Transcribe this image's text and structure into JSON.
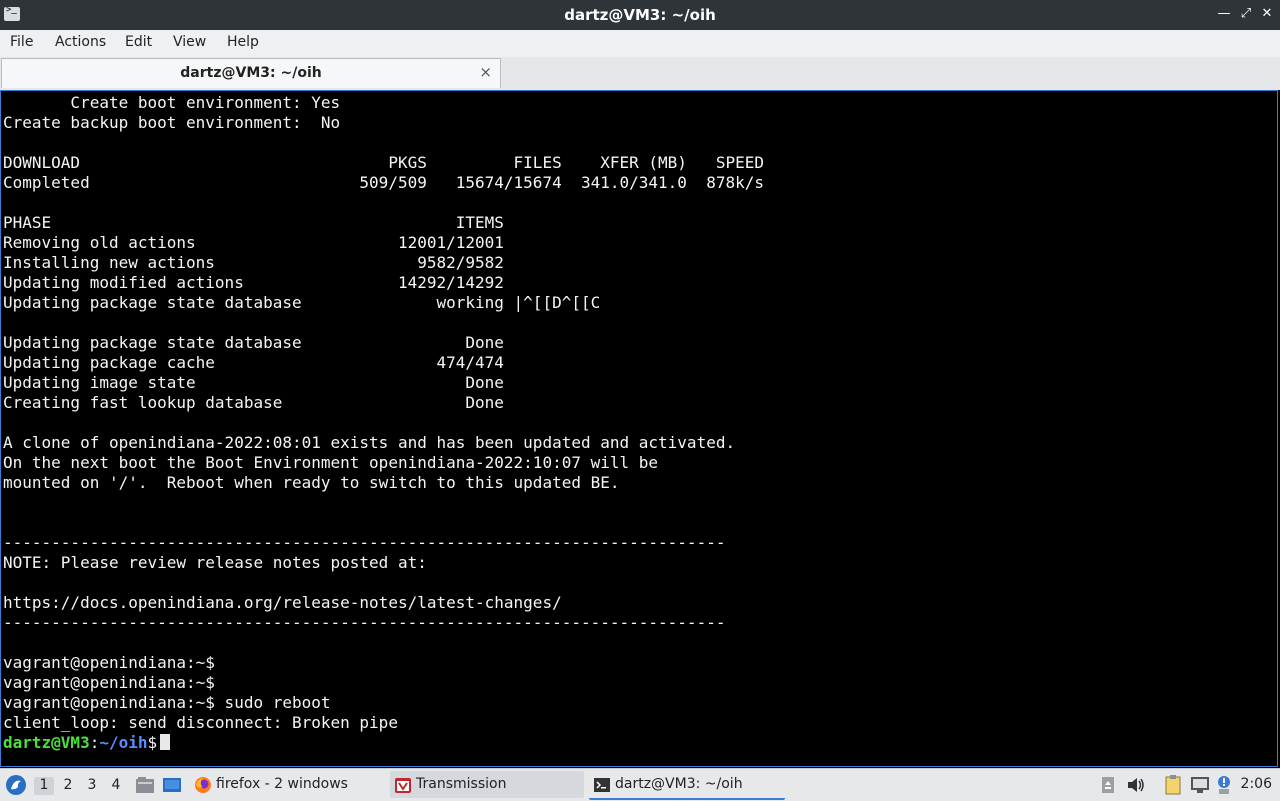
{
  "window": {
    "title": "dartz@VM3: ~/oih"
  },
  "menu": [
    "File",
    "Actions",
    "Edit",
    "View",
    "Help"
  ],
  "tab": {
    "label": "dartz@VM3: ~/oih",
    "close": "×"
  },
  "terminal": {
    "lines": [
      "       Create boot environment: Yes",
      "Create backup boot environment:  No",
      "",
      "DOWNLOAD                                PKGS         FILES    XFER (MB)   SPEED",
      "Completed                            509/509   15674/15674  341.0/341.0  878k/s",
      "",
      "PHASE                                          ITEMS",
      "Removing old actions                     12001/12001",
      "Installing new actions                     9582/9582",
      "Updating modified actions                14292/14292",
      "Updating package state database              working |^[[D^[[C",
      "",
      "Updating package state database                 Done",
      "Updating package cache                       474/474",
      "Updating image state                            Done",
      "Creating fast lookup database                   Done",
      "",
      "A clone of openindiana-2022:08:01 exists and has been updated and activated.",
      "On the next boot the Boot Environment openindiana-2022:10:07 will be",
      "mounted on '/'.  Reboot when ready to switch to this updated BE.",
      "",
      "",
      "---------------------------------------------------------------------------",
      "NOTE: Please review release notes posted at:",
      "",
      "https://docs.openindiana.org/release-notes/latest-changes/",
      "---------------------------------------------------------------------------",
      "",
      "vagrant@openindiana:~$",
      "vagrant@openindiana:~$",
      "vagrant@openindiana:~$ sudo reboot",
      "client_loop: send disconnect: Broken pipe"
    ],
    "prompt": {
      "user_host": "dartz@VM3",
      "sep": ":",
      "path": "~/oih",
      "symbol": "$"
    }
  },
  "taskbar": {
    "workspaces": [
      "1",
      "2",
      "3",
      "4"
    ],
    "active_workspace": "1",
    "tasks": [
      {
        "label": "firefox - 2 windows",
        "icon": "firefox-icon"
      },
      {
        "label": "Transmission",
        "icon": "transmission-icon"
      },
      {
        "label": "dartz@VM3: ~/oih",
        "icon": "terminal-icon"
      }
    ],
    "clock": "2:06"
  },
  "colors": {
    "prompt_user": "#4be03b",
    "prompt_path": "#5b8cff",
    "terminal_bg": "#000000",
    "terminal_fg": "#f5f5f5",
    "focus_border": "#3a7bd5"
  }
}
